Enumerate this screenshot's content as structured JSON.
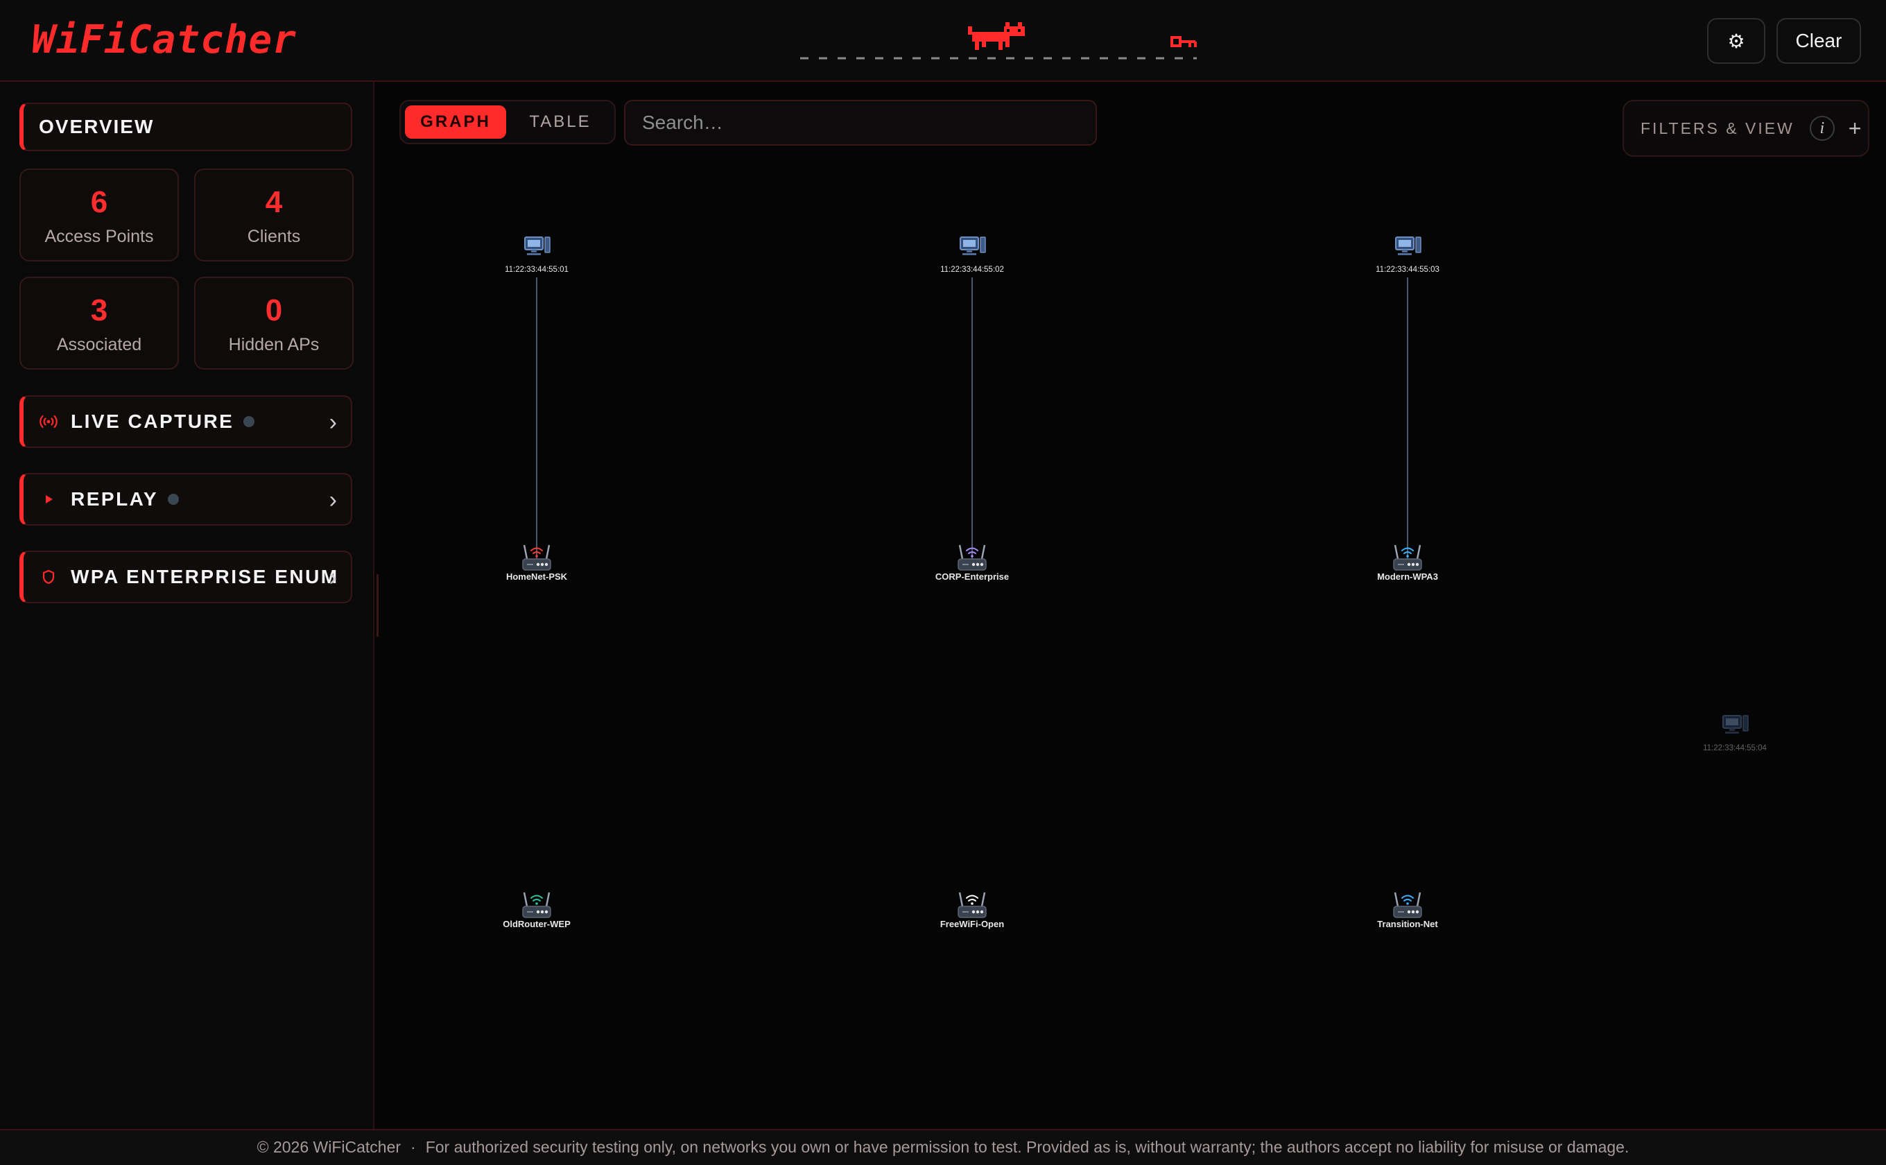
{
  "app": {
    "title": "WiFiCatcher"
  },
  "header": {
    "settings_icon": "⚙",
    "clear_label": "Clear"
  },
  "sidebar": {
    "overview_title": "OVERVIEW",
    "stats": [
      {
        "value": "6",
        "label": "Access Points"
      },
      {
        "value": "4",
        "label": "Clients"
      },
      {
        "value": "3",
        "label": "Associated"
      },
      {
        "value": "0",
        "label": "Hidden APs"
      }
    ],
    "sections": [
      {
        "label": "LIVE CAPTURE",
        "icon": "broadcast-icon",
        "status": "idle"
      },
      {
        "label": "REPLAY",
        "icon": "play-icon",
        "status": "idle"
      },
      {
        "label": "WPA ENTERPRISE ENUM",
        "icon": "shield-icon"
      }
    ],
    "chevron": "›"
  },
  "main": {
    "view_tabs": [
      {
        "label": "GRAPH",
        "active": true
      },
      {
        "label": "TABLE",
        "active": false
      }
    ],
    "search": {
      "placeholder": "Search…",
      "value": ""
    },
    "filters": {
      "label": "FILTERS & VIEW",
      "info_glyph": "i",
      "plus_glyph": "+"
    }
  },
  "graph": {
    "access_points": [
      {
        "ssid": "HomeNet-PSK",
        "wifi_color": "#ff3b3b"
      },
      {
        "ssid": "CORP-Enterprise",
        "wifi_color": "#a98bff"
      },
      {
        "ssid": "Modern-WPA3",
        "wifi_color": "#3ab0ff"
      },
      {
        "ssid": "OldRouter-WEP",
        "wifi_color": "#2ec4a0"
      },
      {
        "ssid": "FreeWiFi-Open",
        "wifi_color": "#ffffff"
      },
      {
        "ssid": "Transition-Net",
        "wifi_color": "#3ab0ff"
      }
    ],
    "clients": [
      {
        "mac": "11:22:33:44:55:01",
        "associated_to": "HomeNet-PSK"
      },
      {
        "mac": "11:22:33:44:55:02",
        "associated_to": "CORP-Enterprise"
      },
      {
        "mac": "11:22:33:44:55:03",
        "associated_to": "Modern-WPA3"
      },
      {
        "mac": "11:22:33:44:55:04",
        "associated_to": null
      }
    ]
  },
  "footer": {
    "copyright": "© 2026 WiFiCatcher",
    "separator": "·",
    "disclaimer": "For authorized security testing only, on networks you own or have permission to test. Provided as is, without warranty; the authors accept no liability for misuse or damage."
  },
  "colors": {
    "accent": "#ff2a2a",
    "background": "#050505",
    "edge": "#4a5a6a"
  }
}
